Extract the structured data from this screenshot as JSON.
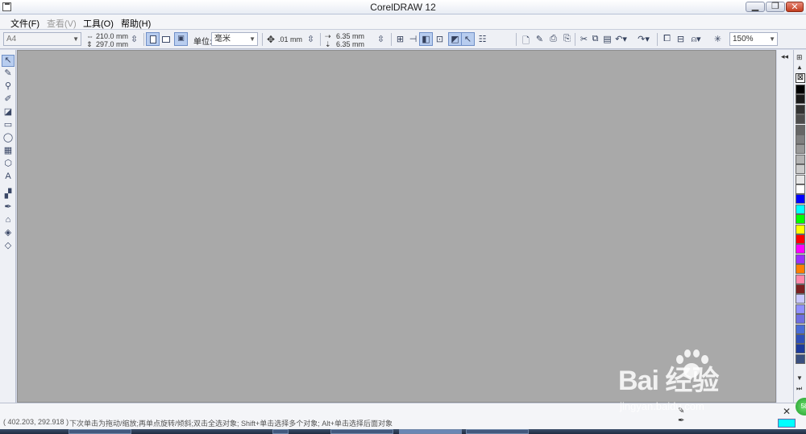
{
  "window": {
    "title": "CorelDRAW 12",
    "min_glyph": "▁",
    "max_glyph": "❐",
    "close_glyph": "✕"
  },
  "menu": [
    {
      "label": "文件(F)",
      "enabled": true
    },
    {
      "label": "查看(V)",
      "enabled": false
    },
    {
      "label": "工具(O)",
      "enabled": true
    },
    {
      "label": "帮助(H)",
      "enabled": true
    }
  ],
  "propbar": {
    "page_size": "A4",
    "width": "210.0 mm",
    "height": "297.0 mm",
    "units_label": "单位:",
    "units_value": "毫米",
    "nudge": ".01 mm",
    "dup_x": "6.35 mm",
    "dup_y": "6.35 mm",
    "zoom": "150%"
  },
  "toolbox": {
    "tools": [
      {
        "name": "pick-tool",
        "glyph": "↖",
        "active": true
      },
      {
        "name": "shape-tool",
        "glyph": "✎",
        "active": false
      },
      {
        "name": "zoom-tool",
        "glyph": "⚲",
        "active": false
      },
      {
        "name": "freehand-tool",
        "glyph": "✐",
        "active": false
      },
      {
        "name": "smart-fill-tool",
        "glyph": "◪",
        "active": false
      },
      {
        "name": "rectangle-tool",
        "glyph": "▭",
        "active": false
      },
      {
        "name": "ellipse-tool",
        "glyph": "◯",
        "active": false
      },
      {
        "name": "graph-paper-tool",
        "glyph": "▦",
        "active": false
      },
      {
        "name": "basic-shapes-tool",
        "glyph": "⬡",
        "active": false
      },
      {
        "name": "text-tool",
        "glyph": "A",
        "active": false
      },
      {
        "name": "interactive-blend-tool",
        "glyph": "▞",
        "active": false
      },
      {
        "name": "eyedropper-tool",
        "glyph": "✒",
        "active": false
      },
      {
        "name": "outline-tool",
        "glyph": "⌂",
        "active": false
      },
      {
        "name": "fill-tool",
        "glyph": "◈",
        "active": false
      },
      {
        "name": "interactive-fill-tool",
        "glyph": "◇",
        "active": false
      }
    ]
  },
  "palette": {
    "nofill_glyph": "⊠",
    "colors": [
      "#000000",
      "#1a1a1a",
      "#333333",
      "#4d4d4d",
      "#666666",
      "#808080",
      "#999999",
      "#b3b3b3",
      "#cccccc",
      "#e6e6e6",
      "#ffffff",
      "#0000ff",
      "#00ffff",
      "#00ff00",
      "#ffff00",
      "#ff0000",
      "#ff00ff",
      "#9b30ff",
      "#ff7f00",
      "#ff88aa",
      "#7a2020",
      "#c8c8ff",
      "#9090ff",
      "#6f6fe0",
      "#4a6cd6",
      "#2f4fb8",
      "#1c3a9c",
      "#3a4f7f"
    ],
    "scroll_up": "▲",
    "scroll_down": "▼",
    "scroll_end": "⏭"
  },
  "status": {
    "coords": "( 402.203, 292.918 )",
    "hint": "下次单击为拖动/缩放;再单点旋转/倾斜;双击全选对象; Shift+单击选择多个对象; Alt+单击选择后面对象",
    "outline_glyph": "✕",
    "green_badge": "58"
  },
  "watermark": {
    "brand": "Bai  经验",
    "url": "jingyan.baidu.com"
  }
}
